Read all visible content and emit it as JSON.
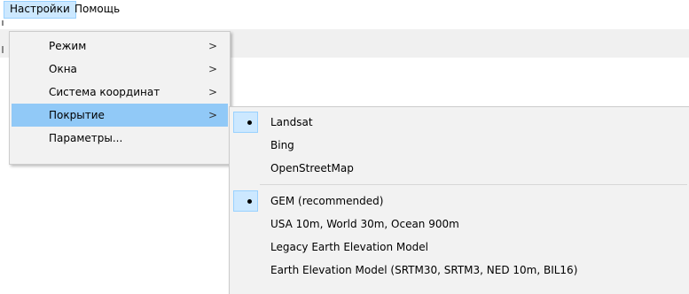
{
  "menubar": {
    "items": [
      {
        "label": "Настройки"
      },
      {
        "label": "Помощь"
      }
    ]
  },
  "settings_menu": {
    "items": [
      {
        "label": "Режим",
        "has_submenu": true
      },
      {
        "label": "Окна",
        "has_submenu": true
      },
      {
        "label": "Система координат",
        "has_submenu": true
      },
      {
        "label": "Покрытие",
        "has_submenu": true,
        "highlighted": true
      },
      {
        "label": "Параметры...",
        "has_submenu": false
      }
    ],
    "submenu_arrow": ">"
  },
  "coverage_submenu": {
    "imagery_group": [
      {
        "label": "Landsat",
        "selected": true
      },
      {
        "label": "Bing",
        "selected": false
      },
      {
        "label": "OpenStreetMap",
        "selected": false
      }
    ],
    "elevation_group": [
      {
        "label": "GEM (recommended)",
        "selected": true
      },
      {
        "label": "USA 10m, World 30m, Ocean 900m",
        "selected": false
      },
      {
        "label": "Legacy Earth Elevation Model",
        "selected": false
      },
      {
        "label": "Earth Elevation Model (SRTM30, SRTM3, NED 10m, BIL16)",
        "selected": false
      }
    ]
  },
  "colors": {
    "menu_background": "#f2f2f2",
    "menu_highlight": "#91c9f7",
    "menubar_active": "#cce8ff",
    "check_background": "#cce8ff"
  }
}
